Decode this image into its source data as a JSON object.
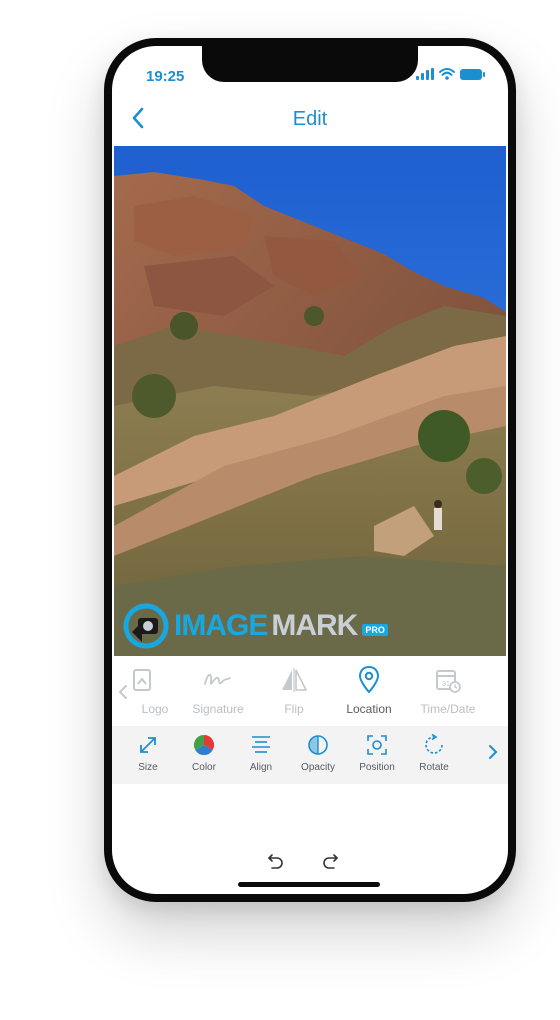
{
  "status": {
    "time": "19:25"
  },
  "nav": {
    "title": "Edit"
  },
  "watermark": {
    "brand_blue": "IMAGE",
    "brand_gray": "MARK",
    "badge": "PRO"
  },
  "tabs": [
    {
      "label": "Logo",
      "icon": "logo-icon",
      "active": false
    },
    {
      "label": "Signature",
      "icon": "signature-icon",
      "active": false
    },
    {
      "label": "Flip",
      "icon": "flip-icon",
      "active": false
    },
    {
      "label": "Location",
      "icon": "location-pin-icon",
      "active": true
    },
    {
      "label": "Time/Date",
      "icon": "calendar-clock-icon",
      "active": false
    }
  ],
  "tools": [
    {
      "label": "Size",
      "icon": "resize-arrows-icon"
    },
    {
      "label": "Color",
      "icon": "color-wheel-icon"
    },
    {
      "label": "Align",
      "icon": "align-lines-icon"
    },
    {
      "label": "Opacity",
      "icon": "opacity-icon"
    },
    {
      "label": "Position",
      "icon": "position-icon"
    },
    {
      "label": "Rotate",
      "icon": "rotate-icon"
    }
  ],
  "colors": {
    "accent": "#1b8fd0",
    "sky": "#2a6fdb",
    "inactive": "#b9bfc5"
  }
}
